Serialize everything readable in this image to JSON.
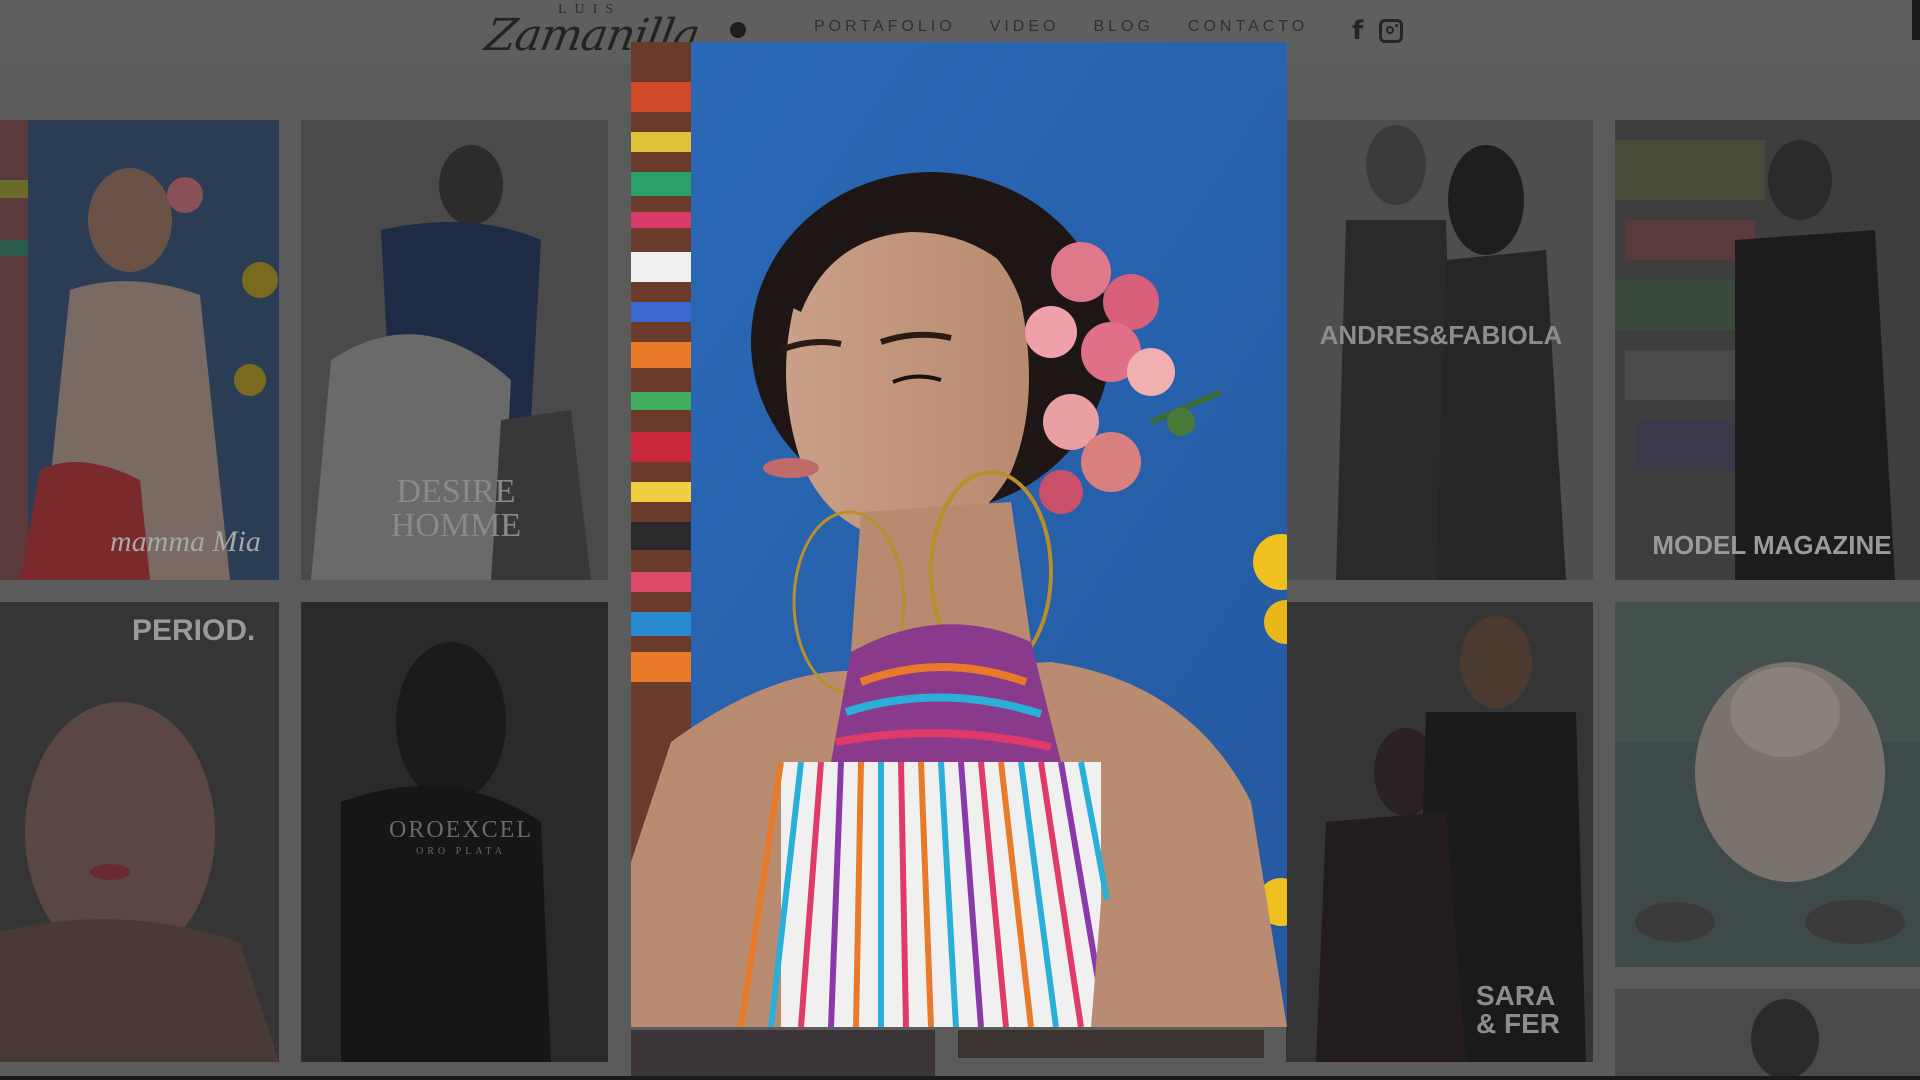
{
  "site": {
    "logo_small": "LUIS",
    "logo_script": "Zamanilla"
  },
  "nav": {
    "items": [
      {
        "label": "PORTAFOLIO"
      },
      {
        "label": "VIDEO"
      },
      {
        "label": "BLOG"
      },
      {
        "label": "CONTACTO"
      }
    ]
  },
  "social": {
    "facebook_icon": "facebook-icon",
    "instagram_icon": "instagram-icon",
    "facebook_glyph": "f"
  },
  "tiles": [
    {
      "id": "mamma-mia",
      "title": "mamma Mia"
    },
    {
      "id": "desire-homme",
      "title": "DESIRE HOMME"
    },
    {
      "id": "andres-fabiola",
      "title": "ANDRES&FABIOLA"
    },
    {
      "id": "model-magazine",
      "title": "MODEL MAGAZINE"
    },
    {
      "id": "period",
      "title": "PERIOD."
    },
    {
      "id": "oroexcel",
      "title": "OROEXCEL",
      "subtitle": "ORO PLATA"
    },
    {
      "id": "sara-fer",
      "title": "SARA & FER"
    },
    {
      "id": "cat",
      "title": ""
    }
  ],
  "colors": {
    "overlay_bg": "#5b5b5b",
    "lightbox_bg": "#2f66ae"
  }
}
